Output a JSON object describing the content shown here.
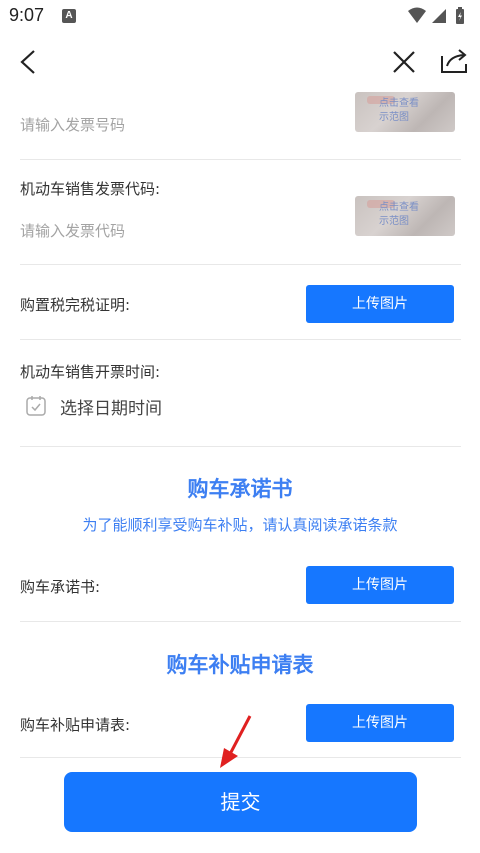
{
  "status": {
    "time": "9:07",
    "app_badge": "A"
  },
  "nav": {
    "back": "back-icon",
    "close": "close-icon",
    "share": "share-icon"
  },
  "form": {
    "invoice_number": {
      "placeholder": "请输入发票号码",
      "sample_text_line1": "点击查看",
      "sample_text_line2": "示范图"
    },
    "invoice_code": {
      "label": "机动车销售发票代码:",
      "placeholder": "请输入发票代码",
      "sample_text_line1": "点击查看",
      "sample_text_line2": "示范图"
    },
    "tax_certificate": {
      "label": "购置税完税证明:",
      "button": "上传图片"
    },
    "invoice_time": {
      "label": "机动车销售开票时间:",
      "date_placeholder": "选择日期时间"
    }
  },
  "commitment": {
    "title": "购车承诺书",
    "subtitle": "为了能顺利享受购车补贴，请认真阅读承诺条款",
    "label": "购车承诺书:",
    "button": "上传图片"
  },
  "application": {
    "title": "购车补贴申请表",
    "label": "购车补贴申请表:",
    "button": "上传图片"
  },
  "submit": {
    "label": "提交"
  },
  "colors": {
    "primary": "#1677ff",
    "title_blue": "#3d7ff2",
    "annotation_arrow": "#e02020"
  }
}
